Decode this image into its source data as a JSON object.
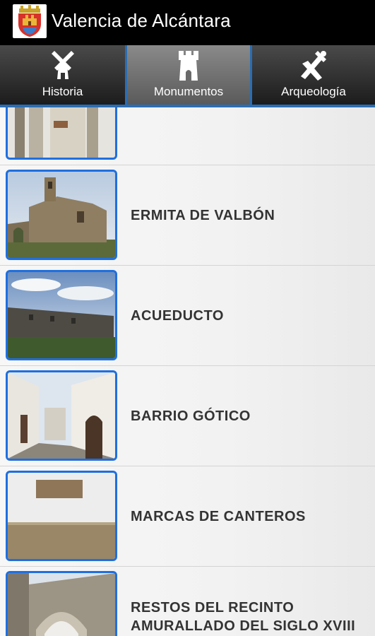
{
  "app": {
    "title": "Valencia de Alcántara",
    "icon": "coat-of-arms-icon"
  },
  "tabs": [
    {
      "label": "Historia",
      "icon": "windmill-icon",
      "active": false
    },
    {
      "label": "Monumentos",
      "icon": "tower-icon",
      "active": true
    },
    {
      "label": "Arqueología",
      "icon": "archaeology-tools-icon",
      "active": false
    }
  ],
  "list": {
    "items": [
      {
        "label": "",
        "thumb": "stone-gate-photo"
      },
      {
        "label": "ERMITA DE VALBÓN",
        "thumb": "stone-chapel-photo"
      },
      {
        "label": "ACUEDUCTO",
        "thumb": "aqueduct-photo"
      },
      {
        "label": "BARRIO GÓTICO",
        "thumb": "gothic-street-photo"
      },
      {
        "label": "MARCAS DE CANTEROS",
        "thumb": "stonemason-marks-photo"
      },
      {
        "label": "RESTOS DEL RECINTO AMURALLADO DEL SIGLO XVIII",
        "thumb": "stone-arch-photo"
      }
    ]
  },
  "colors": {
    "accent": "#1f6fe0",
    "tab_indicator": "#2a6db3",
    "actionbar": "#000000"
  }
}
